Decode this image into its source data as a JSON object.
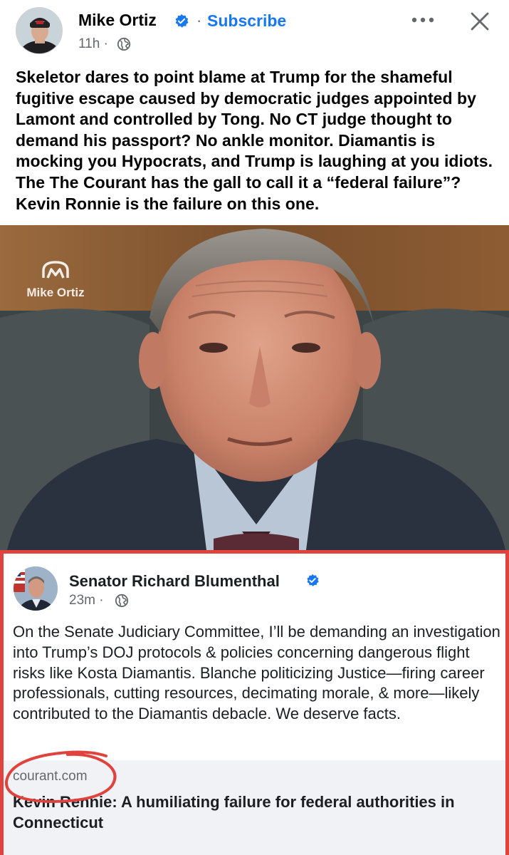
{
  "post": {
    "author": "Mike Ortiz",
    "separator": "·",
    "subscribe_label": "Subscribe",
    "time": "11h ·",
    "text": "Skeletor dares to point blame at Trump for the shameful fugitive escape caused by democratic judges appointed by Lamont and controlled by Tong. No CT judge thought to demand his passport? No ankle monitor. Diamantis is mocking you Hypocrats, and Trump is laughing at you idiots. The The Courant has the gall to call it a “federal failure”?  Kevin Ronnie is the failure on this one.",
    "accent_color": "#1877f2"
  },
  "image": {
    "watermark": "Mike Ortiz"
  },
  "embed": {
    "author": "Senator Richard Blumenthal",
    "time": "23m ·",
    "text": "On the Senate Judiciary Committee, I’ll be demanding an investigation into Trump’s DOJ protocols & policies concerning dangerous flight risks like Kosta Diamantis. Blanche politicizing Justice—firing career professionals, cutting resources, decimating morale, & more—likely contributed to the Diamantis debacle. We deserve facts.",
    "link": {
      "domain": "courant.com",
      "title": "Kevin Rennie: A humiliating failure for federal authorities in Connecticut"
    },
    "border_color": "#e0433d"
  },
  "icons": [
    "verified-badge-icon",
    "globe-icon",
    "more-options-icon",
    "close-icon"
  ]
}
